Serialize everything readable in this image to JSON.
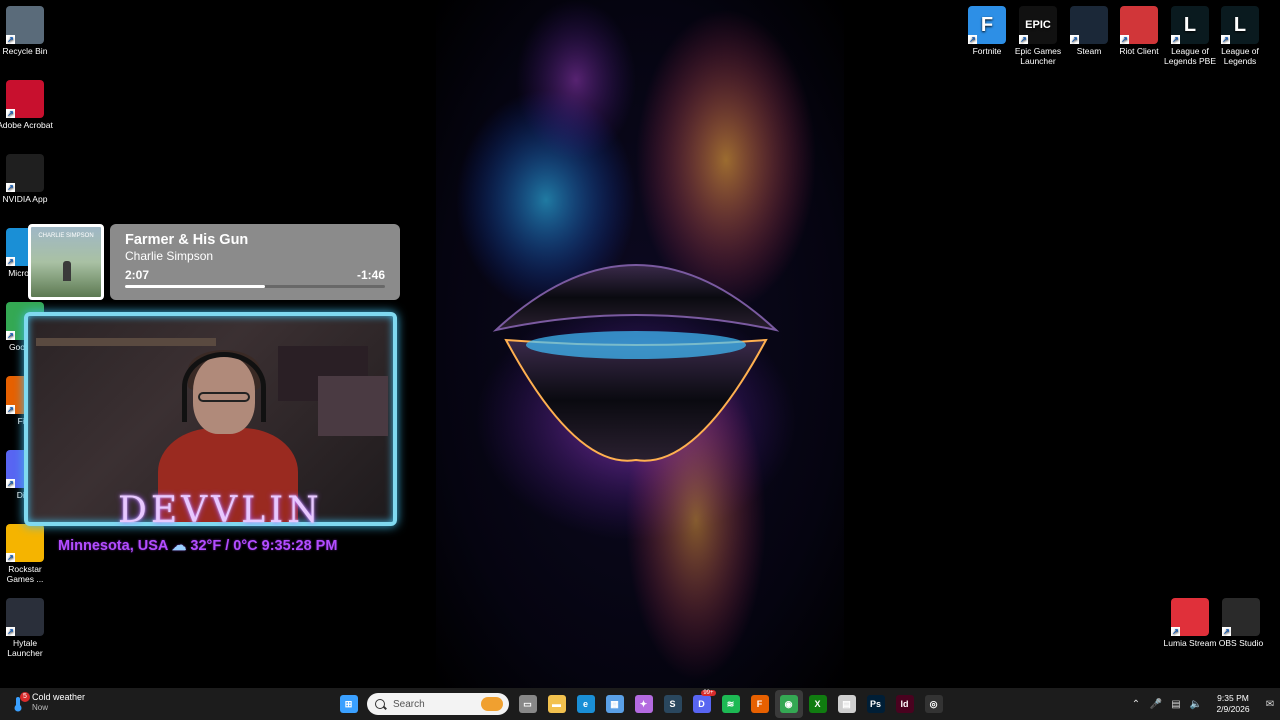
{
  "desktop_icons_left": [
    {
      "label": "Recycle Bin",
      "icon": "recycle-bin-icon",
      "color": "#5a6b7a"
    },
    {
      "label": "Adobe Acrobat",
      "icon": "adobe-acrobat-icon",
      "color": "#c8102e"
    },
    {
      "label": "NVIDIA App",
      "icon": "nvidia-icon",
      "color": "#1f1f1f"
    },
    {
      "label": "Micro Ed",
      "icon": "edge-icon",
      "color": "#1a8fd6"
    },
    {
      "label": "Goo Chr",
      "icon": "chrome-icon",
      "color": "#34a853"
    },
    {
      "label": "Fire",
      "icon": "firefox-icon",
      "color": "#e66000"
    },
    {
      "label": "Disc",
      "icon": "discord-icon",
      "color": "#5865f2"
    },
    {
      "label": "Rockstar Games ...",
      "icon": "rockstar-icon",
      "color": "#f5b400"
    },
    {
      "label": "Hytale Launcher",
      "icon": "hytale-icon",
      "color": "#2a2f3a"
    }
  ],
  "desktop_icons_right": [
    {
      "label": "Fortnite",
      "icon": "fortnite-icon",
      "glyph": "F",
      "color": "#2d8fe6"
    },
    {
      "label": "Epic Games Launcher",
      "icon": "epic-games-icon",
      "glyph": "EPIC",
      "color": "#111111"
    },
    {
      "label": "Steam",
      "icon": "steam-icon",
      "glyph": "",
      "color": "#1b2838"
    },
    {
      "label": "Riot Client",
      "icon": "riot-client-icon",
      "glyph": "",
      "color": "#d13639"
    },
    {
      "label": "League of Legends PBE",
      "icon": "league-pbe-icon",
      "glyph": "L",
      "color": "#0a1a1f"
    },
    {
      "label": "League of Legends",
      "icon": "league-icon",
      "glyph": "L",
      "color": "#0a1a1f"
    }
  ],
  "desktop_icons_bottom_right": [
    {
      "label": "Lumia Stream",
      "icon": "lumia-stream-icon",
      "color": "#e0303a"
    },
    {
      "label": "OBS Studio",
      "icon": "obs-studio-icon",
      "color": "#2a2a2a"
    }
  ],
  "now_playing": {
    "track": "Farmer & His Gun",
    "artist": "Charlie Simpson",
    "elapsed": "2:07",
    "remaining": "-1:46",
    "progress": 0.54,
    "album_art_text": "CHARLIE SIMPSON"
  },
  "overlay": {
    "name": "DEVVLIN",
    "location": "Minnesota, USA",
    "temperature": "32°F / 0°C",
    "time": "9:35:28 PM"
  },
  "taskbar": {
    "weather_title": "Cold weather",
    "weather_sub": "Now",
    "weather_badge": "5",
    "search_placeholder": "Search",
    "pinned": [
      {
        "name": "start-button",
        "color": "#3aa0ff",
        "glyph": "⊞"
      },
      {
        "name": "task-view-icon",
        "color": "#888888",
        "glyph": "▭"
      },
      {
        "name": "file-explorer-icon",
        "color": "#f2c14e",
        "glyph": "▬"
      },
      {
        "name": "edge-icon",
        "color": "#1a8fd6",
        "glyph": "e"
      },
      {
        "name": "store-icon",
        "color": "#5aa0e6",
        "glyph": "▦"
      },
      {
        "name": "copilot-icon",
        "color": "#b46be0",
        "glyph": "✦"
      },
      {
        "name": "steam-icon",
        "color": "#2a475e",
        "glyph": "S"
      },
      {
        "name": "discord-icon",
        "color": "#5865f2",
        "glyph": "D",
        "badge": "99+"
      },
      {
        "name": "spotify-icon",
        "color": "#1db954",
        "glyph": "≋"
      },
      {
        "name": "firefox-icon",
        "color": "#e66000",
        "glyph": "F"
      },
      {
        "name": "chrome-icon",
        "color": "#34a853",
        "glyph": "◉",
        "active": true
      },
      {
        "name": "xbox-icon",
        "color": "#107c10",
        "glyph": "X"
      },
      {
        "name": "notepad-icon",
        "color": "#cfcfcf",
        "glyph": "▤"
      },
      {
        "name": "photoshop-icon",
        "color": "#001e36",
        "glyph": "Ps"
      },
      {
        "name": "indesign-icon",
        "color": "#49021f",
        "glyph": "Id"
      },
      {
        "name": "obs-icon",
        "color": "#333333",
        "glyph": "◎"
      }
    ],
    "tray_icons": [
      "chevron-up-icon",
      "microphone-icon",
      "network-icon",
      "volume-icon"
    ],
    "clock_time": "9:35 PM",
    "clock_date": "2/9/2026"
  }
}
